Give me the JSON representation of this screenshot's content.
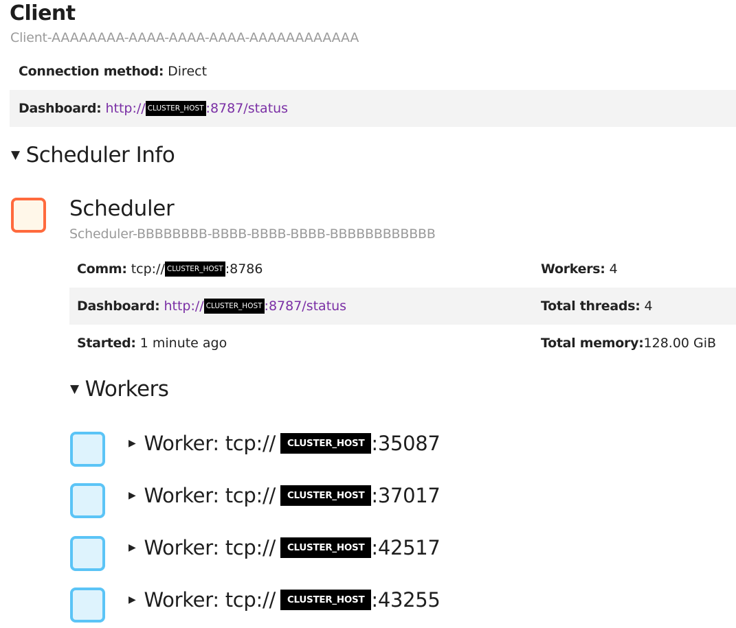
{
  "client": {
    "title": "Client",
    "id": "Client-AAAAAAAA-AAAA-AAAA-AAAA-AAAAAAAAAAAA",
    "connection_label": "Connection method:",
    "connection_value": "Direct",
    "dashboard_label": "Dashboard:",
    "dashboard_prefix": "http://",
    "dashboard_host": "CLUSTER_HOST",
    "dashboard_suffix": ":8787/status"
  },
  "scheduler_info": {
    "heading": "Scheduler Info",
    "toggle_icon": "triangle-down",
    "scheduler": {
      "title": "Scheduler",
      "id": "Scheduler-BBBBBBBB-BBBB-BBBB-BBBB-BBBBBBBBBBBB",
      "color": "#ff6a3d",
      "comm_label": "Comm:",
      "comm_prefix": "tcp://",
      "comm_host": "CLUSTER_HOST",
      "comm_suffix": ":8786",
      "dashboard_label": "Dashboard:",
      "dashboard_prefix": "http://",
      "dashboard_host": "CLUSTER_HOST",
      "dashboard_suffix": ":8787/status",
      "started_label": "Started:",
      "started_value": "1 minute ago",
      "workers_label": "Workers:",
      "workers_value": "4",
      "threads_label": "Total threads:",
      "threads_value": "4",
      "memory_label": "Total memory:",
      "memory_value": "128.00 GiB"
    }
  },
  "workers": {
    "heading": "Workers",
    "color": "#5bc4f6",
    "label": "Worker: tcp://",
    "host": "CLUSTER_HOST",
    "items": [
      {
        "port": ":35087"
      },
      {
        "port": ":37017"
      },
      {
        "port": ":42517"
      },
      {
        "port": ":43255"
      }
    ]
  }
}
